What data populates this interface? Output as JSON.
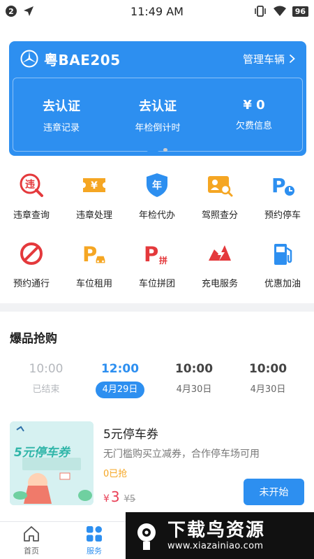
{
  "status_bar": {
    "notification_count": "2",
    "time": "11:49 AM",
    "battery": "96"
  },
  "vehicle": {
    "plate": "粤BAE205",
    "manage_label": "管理车辆",
    "stats": [
      {
        "value": "去认证",
        "label": "违章记录"
      },
      {
        "value": "去认证",
        "label": "年检倒计时"
      },
      {
        "value": "¥ 0",
        "label": "欠费信息"
      }
    ]
  },
  "carousel": {
    "pages": 2,
    "active_page": 1
  },
  "services": [
    {
      "label": "违章查询",
      "icon": "violation-search-icon",
      "glyph": "违"
    },
    {
      "label": "违章处理",
      "icon": "ticket-icon",
      "glyph": "¥"
    },
    {
      "label": "年检代办",
      "icon": "annual-inspection-shield-icon",
      "glyph": "年"
    },
    {
      "label": "驾照查分",
      "icon": "license-score-icon",
      "glyph": ""
    },
    {
      "label": "预约停车",
      "icon": "parking-reservation-icon",
      "glyph": "P"
    },
    {
      "label": "预约通行",
      "icon": "no-entry-icon",
      "glyph": ""
    },
    {
      "label": "车位租用",
      "icon": "parking-rental-icon",
      "glyph": "P"
    },
    {
      "label": "车位拼团",
      "icon": "parking-groupbuy-icon",
      "glyph": "P",
      "glyph2": "拼"
    },
    {
      "label": "充电服务",
      "icon": "charging-icon",
      "glyph": ""
    },
    {
      "label": "优惠加油",
      "icon": "fuel-pump-icon",
      "glyph": ""
    }
  ],
  "flash_sale": {
    "title": "爆品抢购",
    "time_slots": [
      {
        "time": "10:00",
        "sub": "已结束",
        "state": "ended"
      },
      {
        "time": "12:00",
        "sub": "4月29日",
        "state": "active"
      },
      {
        "time": "10:00",
        "sub": "4月30日",
        "state": "upcoming"
      },
      {
        "time": "10:00",
        "sub": "4月30日",
        "state": "upcoming"
      }
    ],
    "product": {
      "image_text": "5元停车券",
      "name": "5元停车券",
      "desc": "无门槛购买立减券，合作停车场可用",
      "sold": "0已抢",
      "currency": "¥",
      "price": "3",
      "original_price": "¥5",
      "button_label": "未开始"
    }
  },
  "bottom_nav": [
    {
      "label": "首页",
      "icon": "home-icon",
      "active": false
    },
    {
      "label": "服务",
      "icon": "services-grid-icon",
      "active": true
    }
  ],
  "watermark": {
    "title": "下载鸟资源",
    "url": "www.xiazainiao.com"
  },
  "colors": {
    "primary": "#2d8ff0",
    "red": "#e4393c",
    "orange": "#f5a623",
    "price": "#e94057"
  }
}
